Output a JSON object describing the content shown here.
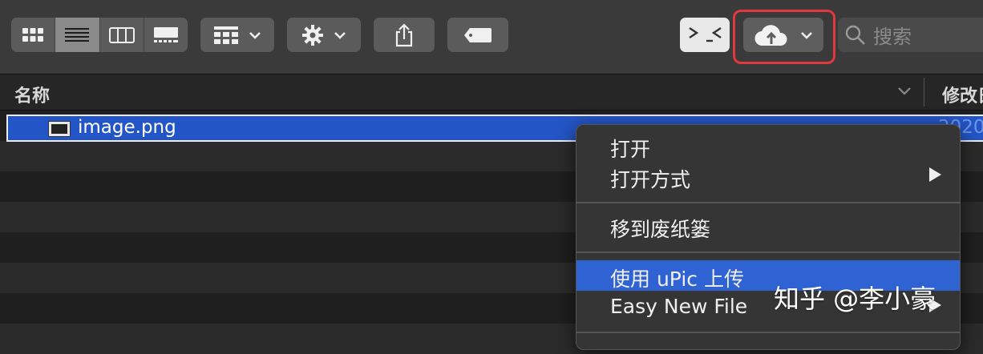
{
  "toolbar": {
    "view_modes": [
      {
        "icon": "icon-view-icon",
        "active": false
      },
      {
        "icon": "list-view-icon",
        "active": true
      },
      {
        "icon": "column-view-icon",
        "active": false
      },
      {
        "icon": "gallery-view-icon",
        "active": false
      }
    ],
    "group_icon": "group-grid-icon",
    "action_icon": "gear-icon",
    "share_icon": "share-icon",
    "tag_icon": "tag-icon",
    "terminal_icon": "terminal-icon",
    "upic_icon": "cloud-upload-icon",
    "highlight_color": "#e0383e",
    "search_placeholder": "搜索"
  },
  "columns": {
    "name": "名称",
    "modified": "修改日"
  },
  "files": [
    {
      "name": "image.png",
      "date": "2020",
      "selected": true
    }
  ],
  "context_menu": {
    "items": [
      {
        "label": "打开",
        "submenu": false
      },
      {
        "label": "打开方式",
        "submenu": true
      },
      {
        "label": "移到废纸篓",
        "submenu": false
      },
      {
        "label": "使用 uPic 上传",
        "submenu": false,
        "highlighted": true
      },
      {
        "label": "Easy New File",
        "submenu": true
      }
    ],
    "highlight_color": "#2f62d2"
  },
  "watermark": "知乎 @李小豪"
}
